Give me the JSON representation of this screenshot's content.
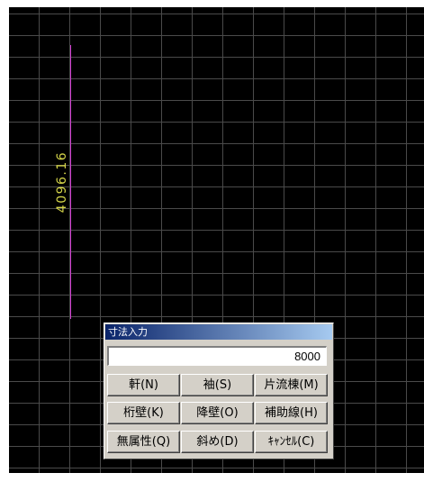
{
  "drawing": {
    "dimension_label": "4096.16",
    "colors": {
      "background": "#000000",
      "grid": "#4a4a4a",
      "line": "#d23cd2",
      "label": "#d6d64a"
    }
  },
  "dialog": {
    "title": "寸法入力",
    "input_value": "8000",
    "buttons": [
      {
        "label": "軒(N)"
      },
      {
        "label": "袖(S)"
      },
      {
        "label": "片流棟(M)"
      },
      {
        "label": "桁壁(K)"
      },
      {
        "label": "降壁(O)"
      },
      {
        "label": "補助線(H)"
      },
      {
        "label": "無属性(Q)"
      },
      {
        "label": "斜め(D)"
      },
      {
        "label": "ｷｬﾝｾﾙ(C)"
      }
    ]
  }
}
